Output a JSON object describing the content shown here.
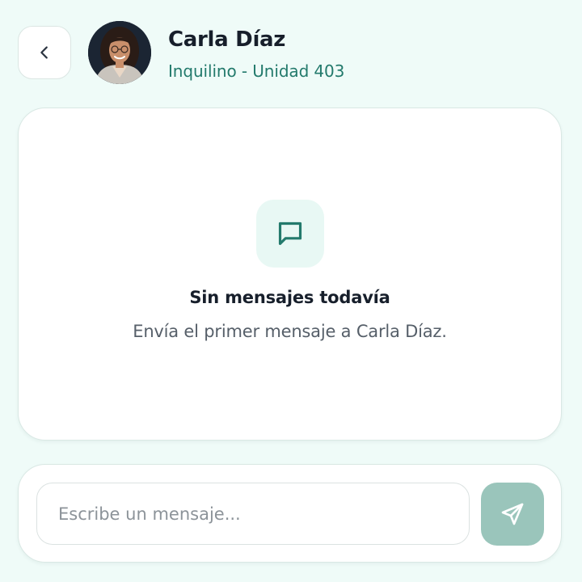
{
  "header": {
    "back_icon": "chevron-left-icon",
    "contact_name": "Carla Díaz",
    "contact_role": "Inquilino - Unidad 403"
  },
  "empty_state": {
    "icon": "message-square-icon",
    "title": "Sin mensajes todavía",
    "subtitle": "Envía el primer mensaje a Carla Díaz."
  },
  "composer": {
    "value": "",
    "placeholder": "Escribe un mensaje...",
    "send_icon": "send-icon"
  },
  "colors": {
    "background": "#effbf8",
    "accent": "#237a6c",
    "send_button": "#9ac5bb",
    "empty_icon_bg": "#e8f8f4"
  }
}
